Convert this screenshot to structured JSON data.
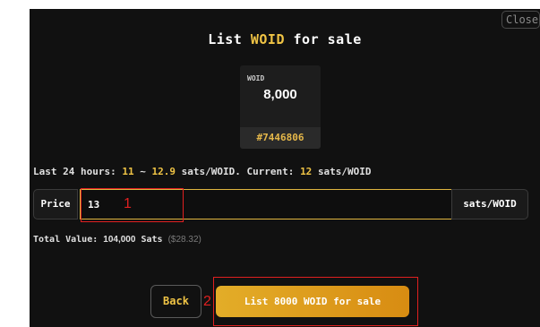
{
  "close_label": "Close",
  "title": {
    "prefix": "List",
    "token": "WOID",
    "suffix": "for sale"
  },
  "card": {
    "ticker": "WOID",
    "amount": "8,000",
    "inscription": "#7446806"
  },
  "stats": {
    "prefix": "Last 24 hours:",
    "low": "11",
    "sep": "~",
    "high": "12.9",
    "unit1": "sats/WOID. Current:",
    "current": "12",
    "unit2": "sats/WOID"
  },
  "price": {
    "label": "Price",
    "value": "13",
    "unit": "sats/WOID"
  },
  "total": {
    "label": "Total Value:",
    "value": "104,000",
    "unit": "Sats",
    "usd": "($28.32)"
  },
  "buttons": {
    "back": "Back",
    "list": "List 8000 WOID for sale"
  },
  "annotations": [
    "1",
    "2"
  ],
  "colors": {
    "accent": "#f0c445",
    "button_gradient_start": "#e3ad28",
    "button_gradient_end": "#d88c12",
    "annotation": "#e02020"
  }
}
